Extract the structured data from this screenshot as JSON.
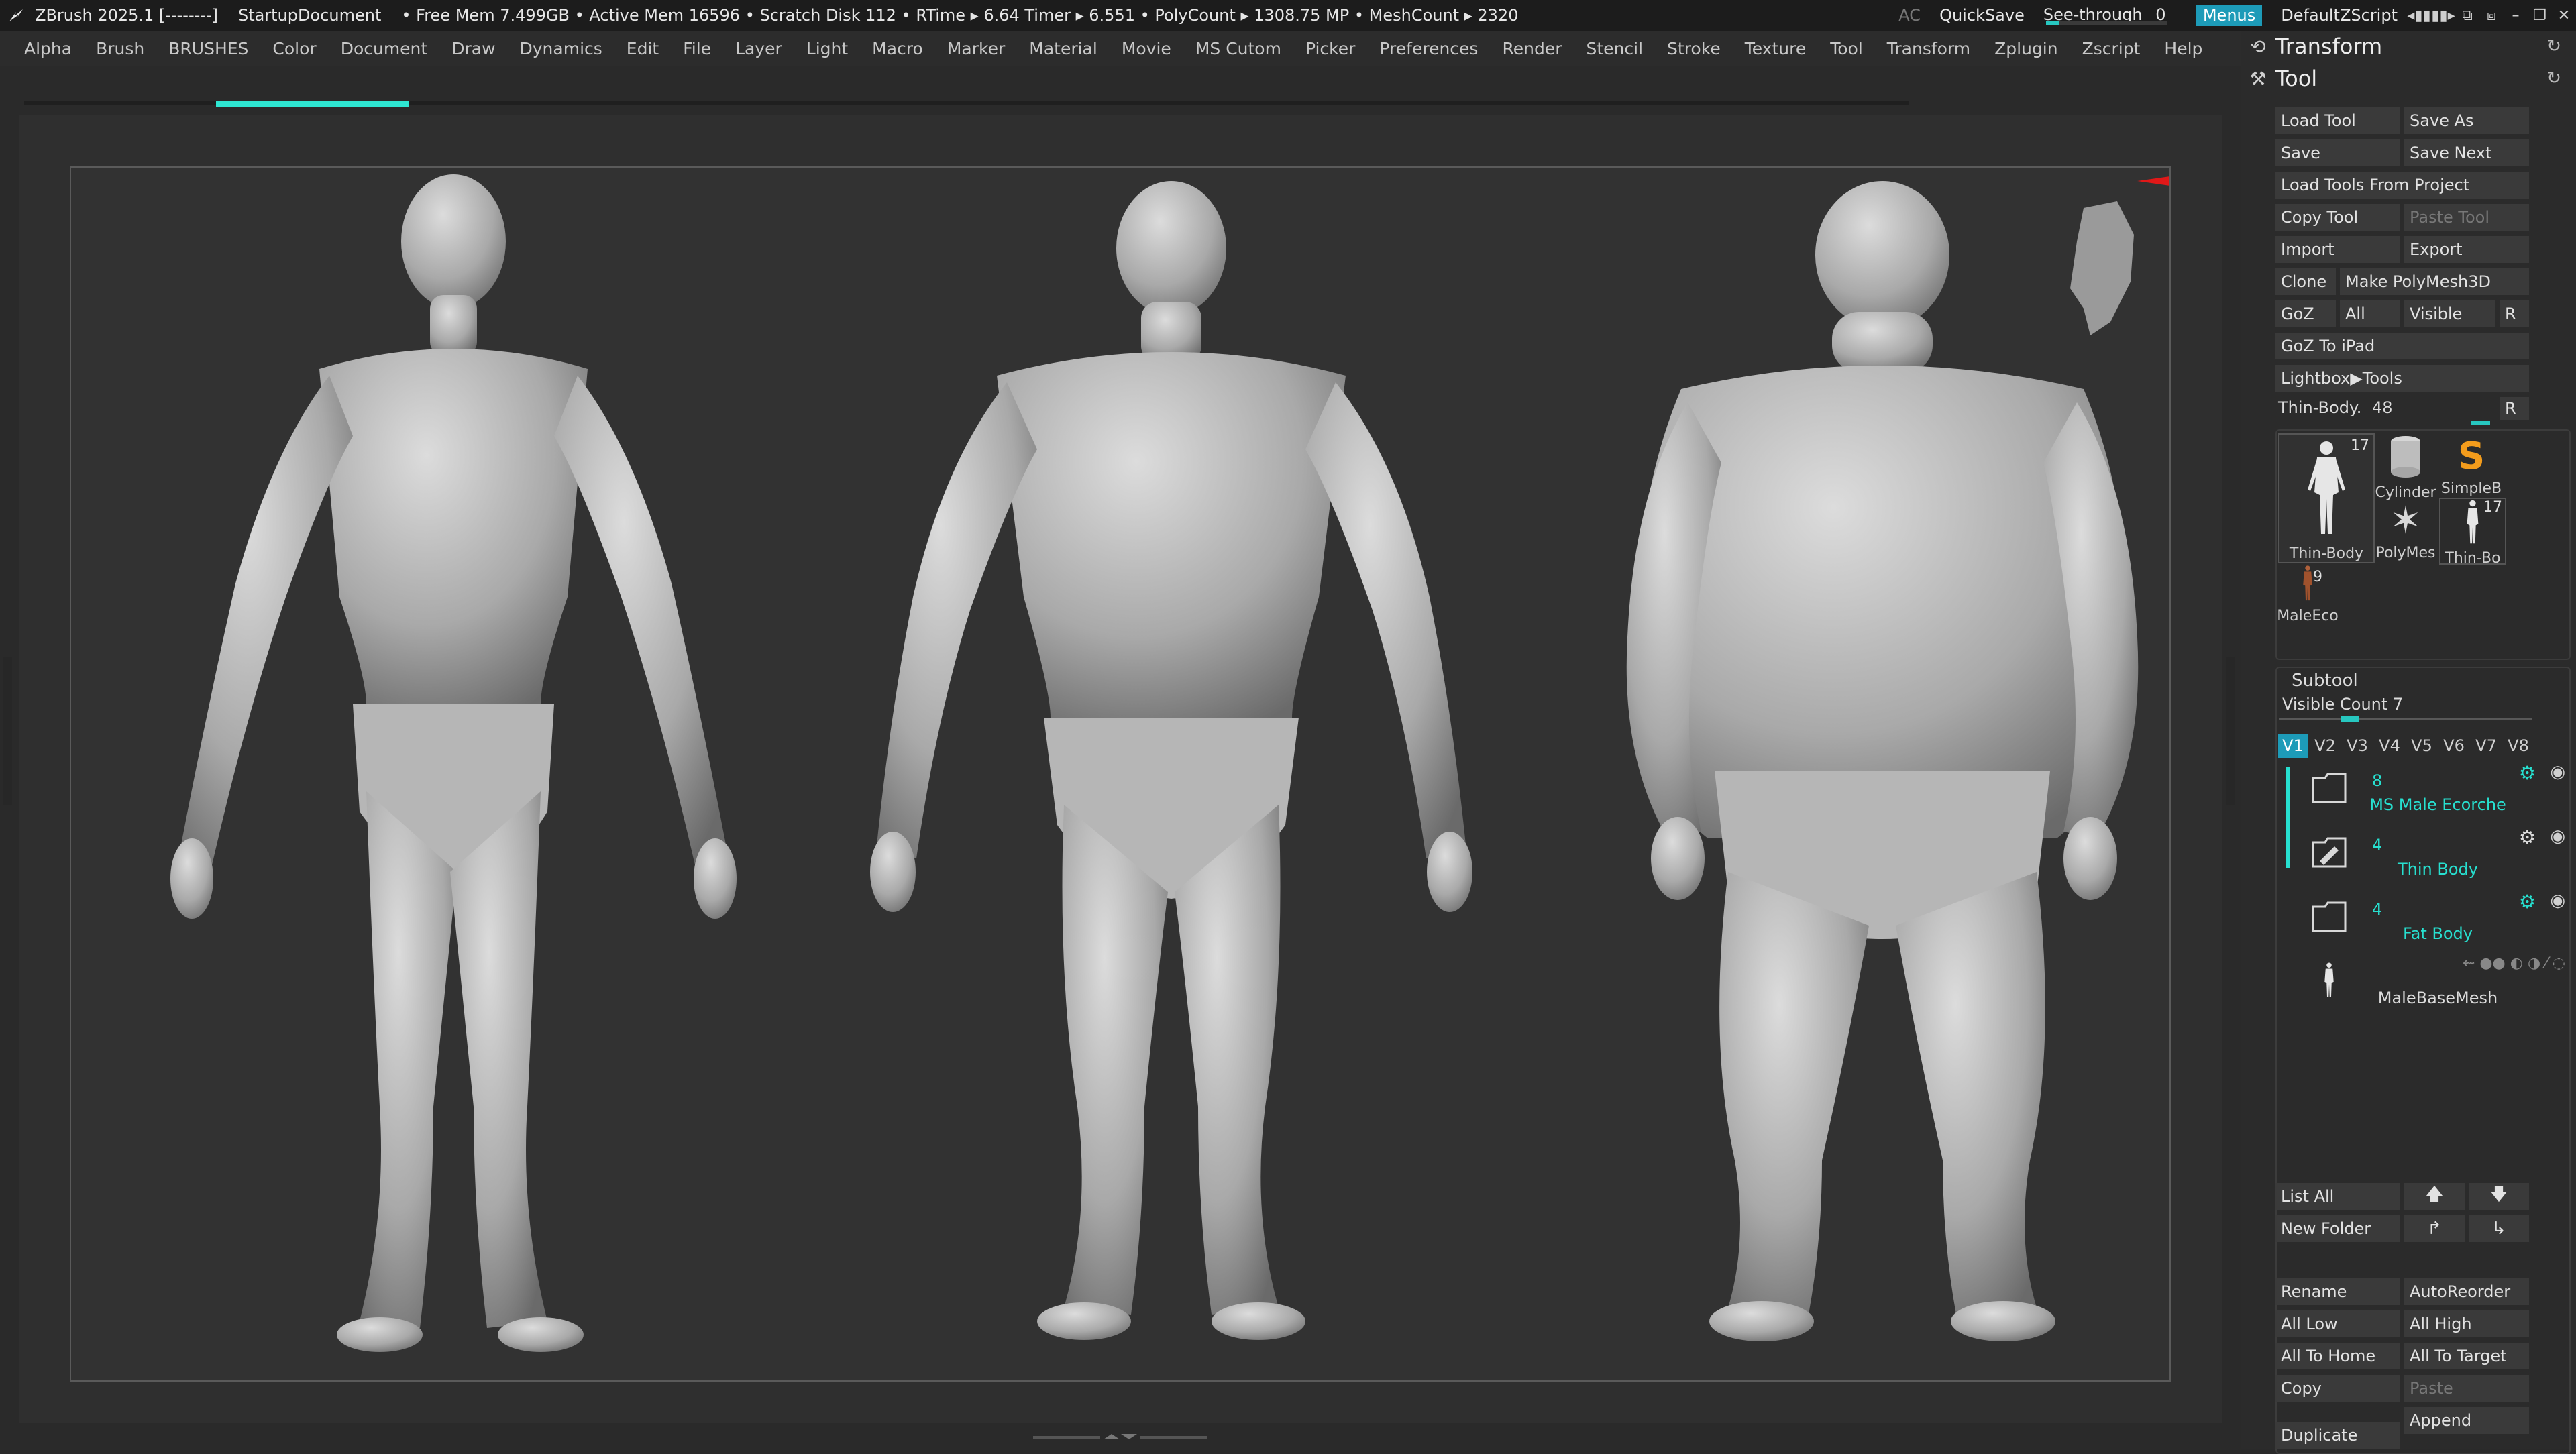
{
  "titlebar": {
    "app": "ZBrush 2025.1 [--------]",
    "document": "StartupDocument",
    "stats": "• Free Mem 7.499GB • Active Mem 16596 • Scratch Disk 112 •  RTime ▸ 6.64 Timer ▸ 6.551 • PolyCount ▸ 1308.75 MP  • MeshCount ▸ 2320",
    "ac": "AC",
    "quicksave": "QuickSave",
    "see_through_label": "See-through",
    "see_through_value": "0",
    "see_through_level": 0,
    "menus": "Menus",
    "script": "DefaultZScript"
  },
  "menubar": [
    "Alpha",
    "Brush",
    "BRUSHES",
    "Color",
    "Document",
    "Draw",
    "Dynamics",
    "Edit",
    "File",
    "Layer",
    "Light",
    "Macro",
    "Marker",
    "Material",
    "Movie",
    "MS Cutom",
    "Picker",
    "Preferences",
    "Render",
    "Stencil",
    "Stroke",
    "Texture",
    "Tool",
    "Transform",
    "Zplugin",
    "Zscript",
    "Help"
  ],
  "panel": {
    "transform_title": "Transform",
    "tool_title": "Tool",
    "buttons": {
      "load_tool": "Load Tool",
      "save_as": "Save As",
      "save": "Save",
      "save_next": "Save Next",
      "load_from_project": "Load Tools From Project",
      "copy_tool": "Copy Tool",
      "paste_tool": "Paste Tool",
      "import": "Import",
      "export": "Export",
      "clone": "Clone",
      "make_polymesh": "Make PolyMesh3D",
      "goz": "GoZ",
      "all": "All",
      "visible": "Visible",
      "r": "R",
      "goz_ipad": "GoZ To iPad",
      "lightbox_tools": "Lightbox▶Tools"
    },
    "current_tool_label": "Thin-Body.",
    "current_tool_value": "48",
    "current_tool_r": "R",
    "tool_thumbs": [
      {
        "label": "Thin-Body",
        "count": "17"
      },
      {
        "label": "Cylinder"
      },
      {
        "label": "SimpleB"
      },
      {
        "label": "PolyMes"
      },
      {
        "label": "Thin-Bo",
        "count": "17"
      },
      {
        "label": "MaleEco",
        "count": "9"
      }
    ],
    "subtool_title": "Subtool",
    "visible_count": "Visible Count 7",
    "visible_count_level": 0.3,
    "v_tabs": [
      "V1",
      "V2",
      "V3",
      "V4",
      "V5",
      "V6",
      "V7",
      "V8"
    ],
    "v_tab_active": "V1",
    "subtools": [
      {
        "count": "8",
        "name": "MS Male Ecorche",
        "kind": "folder"
      },
      {
        "count": "4",
        "name": "Thin Body",
        "kind": "folder-pencil"
      },
      {
        "count": "4",
        "name": "Fat Body",
        "kind": "folder"
      },
      {
        "count": "",
        "name": "MaleBaseMesh",
        "kind": "mesh"
      }
    ],
    "bottom_buttons": {
      "list_all": "List All",
      "new_folder": "New Folder",
      "rename": "Rename",
      "autoreorder": "AutoReorder",
      "all_low": "All Low",
      "all_high": "All High",
      "all_to_home": "All To Home",
      "all_to_target": "All To Target",
      "copy": "Copy",
      "paste": "Paste",
      "append": "Append",
      "duplicate": "Duplicate"
    }
  }
}
